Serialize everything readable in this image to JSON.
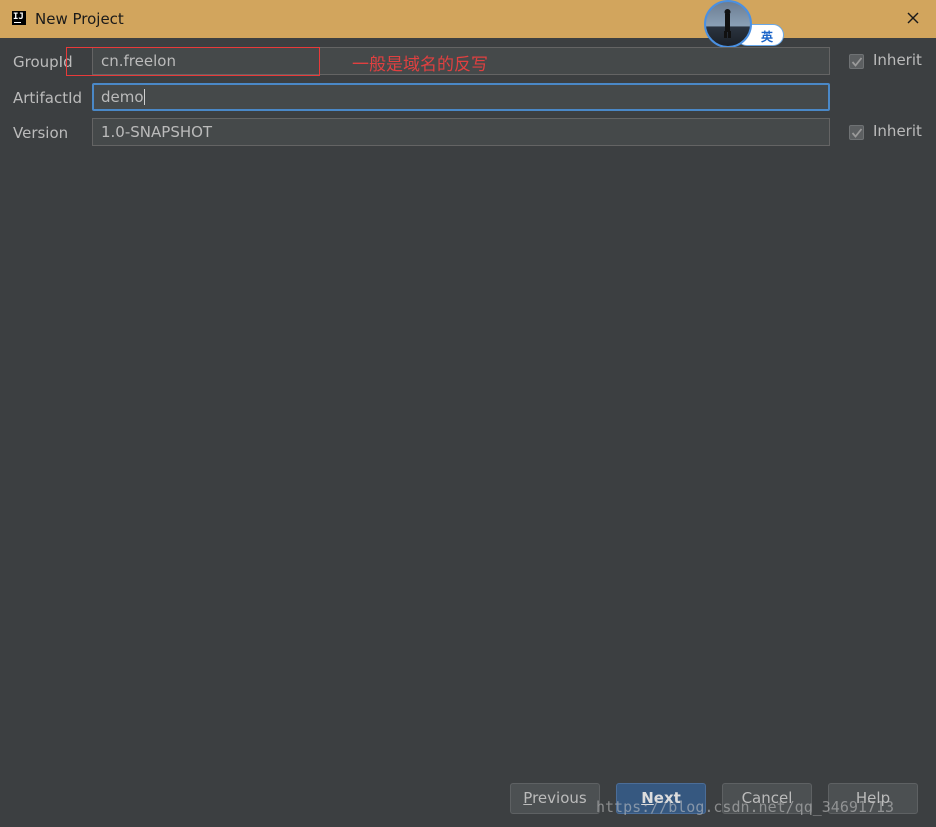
{
  "window": {
    "app_icon_text": "IJ",
    "title": "New Project",
    "close_icon": "close-icon"
  },
  "ime": {
    "indicator_text": "英"
  },
  "form": {
    "group_id": {
      "label": "GroupId",
      "value": "cn.freelon",
      "inherit_label": "Inherit",
      "inherit_checked": true
    },
    "artifact_id": {
      "label": "ArtifactId",
      "value": "demo"
    },
    "version": {
      "label": "Version",
      "value": "1.0-SNAPSHOT",
      "inherit_label": "Inherit",
      "inherit_checked": true
    }
  },
  "annotation": {
    "text": "一般是域名的反写",
    "color": "#e04040"
  },
  "buttons": {
    "previous": {
      "mnemonic": "P",
      "rest": "revious"
    },
    "next": {
      "mnemonic": "N",
      "rest": "ext"
    },
    "cancel": {
      "label": "Cancel"
    },
    "help": {
      "label": "Help"
    }
  },
  "watermark": "https://blog.csdn.net/qq_34691713",
  "colors": {
    "titlebar": "#d2a55d",
    "background": "#3c3f41",
    "focus_border": "#4a88c7",
    "primary_button": "#365880"
  }
}
